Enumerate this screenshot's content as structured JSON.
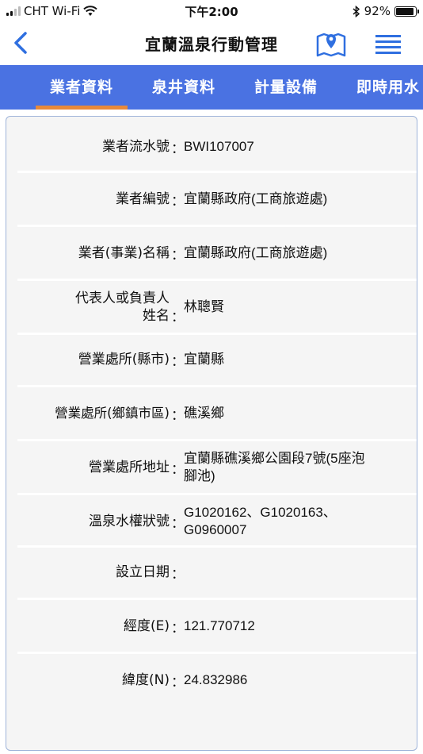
{
  "status_bar": {
    "carrier": "CHT Wi-Fi",
    "time": "下午2:00",
    "battery_percent": "92%",
    "battery_level": 0.92
  },
  "nav": {
    "title": "宜蘭溫泉行動管理",
    "back_icon": "chevron-left-icon",
    "map_icon": "map-pin-icon",
    "menu_icon": "list-menu-icon"
  },
  "tabs": [
    {
      "label": "業者資料",
      "active": true
    },
    {
      "label": "泉井資料",
      "active": false
    },
    {
      "label": "計量設備",
      "active": false
    },
    {
      "label": "即時用水",
      "active": false
    }
  ],
  "colors": {
    "accent": "#4a72e2",
    "tab_indicator": "#e7893a",
    "icon_blue": "#2f6fe0"
  },
  "fields": [
    {
      "label": "業者流水號",
      "value": "BWI107007"
    },
    {
      "label": "業者編號",
      "value": "宜蘭縣政府(工商旅遊處)"
    },
    {
      "label": "業者(事業)名稱",
      "value": "宜蘭縣政府(工商旅遊處)"
    },
    {
      "label_line1": "代表人或負責人",
      "label_line2": "姓名",
      "value": "林聰賢"
    },
    {
      "label": "營業處所(縣市)",
      "value": "宜蘭縣"
    },
    {
      "label": "營業處所(鄉鎮市區)",
      "value": "礁溪鄉"
    },
    {
      "label": "營業處所地址",
      "value_line1": "宜蘭縣礁溪鄉公園段7號(5座泡",
      "value_line2": "腳池)"
    },
    {
      "label": "溫泉水權狀號",
      "value_line1": "G1020162、G1020163、",
      "value_line2": "G0960007"
    },
    {
      "label": "設立日期",
      "value": ""
    },
    {
      "label": "經度(E)",
      "value": "121.770712"
    },
    {
      "label": "緯度(N)",
      "value": "24.832986"
    }
  ],
  "colon": "："
}
